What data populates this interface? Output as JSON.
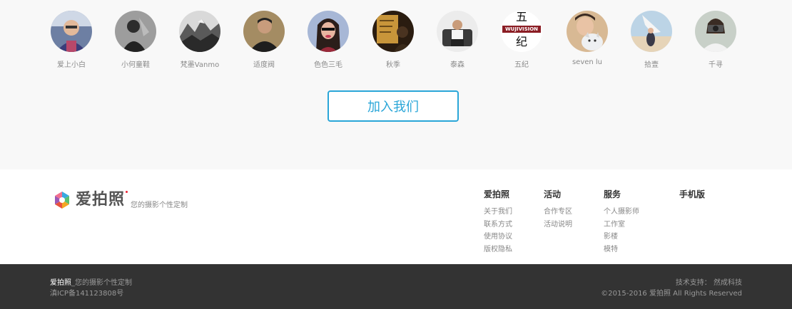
{
  "members": [
    {
      "name": "爱上小白",
      "icon": "avatar-photo"
    },
    {
      "name": "小何童鞋",
      "icon": "avatar-photo"
    },
    {
      "name": "梵墨Vanmo",
      "icon": "avatar-photo"
    },
    {
      "name": "适度阀",
      "icon": "avatar-photo"
    },
    {
      "name": "色色三毛",
      "icon": "avatar-photo"
    },
    {
      "name": "秋季",
      "icon": "avatar-photo"
    },
    {
      "name": "泰森",
      "icon": "avatar-photo"
    },
    {
      "name": "五纪",
      "icon": "avatar-photo",
      "avatar_text_top": "五",
      "avatar_text_banner": "WUJIVISION",
      "avatar_text_bottom": "纪"
    },
    {
      "name": "seven lu",
      "icon": "avatar-photo"
    },
    {
      "name": "拾壹",
      "icon": "avatar-photo"
    },
    {
      "name": "千寻",
      "icon": "avatar-photo"
    }
  ],
  "join_button": "加入我们",
  "footer": {
    "logo_text": "爱拍照",
    "slogan": "您的摄影个性定制",
    "columns": [
      {
        "title": "爱拍照",
        "links": [
          "关于我们",
          "联系方式",
          "使用协议",
          "版权隐私"
        ]
      },
      {
        "title": "活动",
        "links": [
          "合作专区",
          "活动说明"
        ]
      },
      {
        "title": "服务",
        "links": [
          "个人摄影师",
          "工作室",
          "影楼",
          "模特"
        ]
      },
      {
        "title": "手机版",
        "links": []
      }
    ]
  },
  "bottom_bar": {
    "brand": "爱拍照",
    "brand_suffix": "_您的摄影个性定制",
    "icp": "滇ICP备141123808号",
    "tech_support": "技术支持： 然成科技",
    "copyright": "©2015-2016 爱拍照 All Rights Reserved"
  },
  "colors": {
    "accent": "#2aa6d8",
    "bottom_bg": "#333333",
    "members_bg": "#f8f8f8"
  }
}
